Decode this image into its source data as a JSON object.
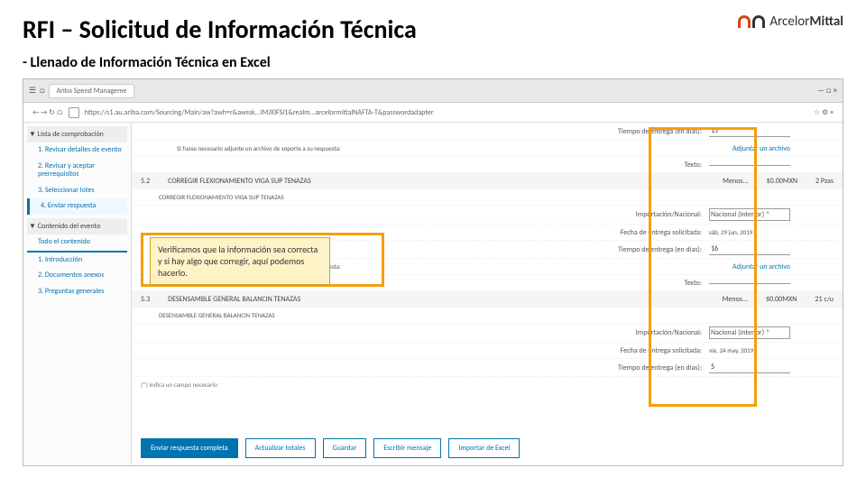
{
  "header": {
    "title": "RFI – Solicitud de Información Técnica",
    "logo_brand1": "Arcelor",
    "logo_brand2": "Mittal"
  },
  "subtitle": "- Llenado de Información Técnica en Excel",
  "browser": {
    "tab": "Ariba Spend Manageme",
    "url": "https://s1.au.ariba.com/Sourcing/Main/aw?awh=r&awssk...IMJI0FSI1&realm...arcelormittalNAFTA-T&passwordadapter"
  },
  "sidebar": {
    "header": "▼ Lista de comprobación",
    "items": [
      "1. Revisar detalles de evento",
      "2. Revisar y aceptar prerrequisitos",
      "3. Seleccionar lotes",
      "4. Enviar respuesta"
    ],
    "section2": "▼ Contenido del evento",
    "items2": [
      "Todo el contenido",
      "1. Introducción",
      "2. Documentos anexos",
      "3. Preguntas generales"
    ]
  },
  "main": {
    "r1_lbl": "Tiempo de entrega (en días):",
    "r1_val": "15",
    "r2_txt": "Si fuese necesario adjunte un archivo de soporte a su respuesta:",
    "r2_lnk": "Adjuntar un archivo",
    "r3_lbl": "Texto:",
    "sec1_num": "5.2",
    "sec1_name": "CORREGIR FLEXIONAMIENTO VIGA SUP TENAZAS",
    "sec1_link": "Menos...",
    "sec1_amt": "$0.00MXN",
    "sec1_qty": "2 Pzas",
    "sec1_sub": "CORREGIR FLEXIONAMIENTO VIGA SUP TENAZAS",
    "r4_lbl": "Importación/Nacional:",
    "r4_val": "Nacional (interior)",
    "r5_lbl": "Fecha de entrega solicitada:",
    "r5_val": "sáb, 29 jun, 2019",
    "r6_lbl": "Tiempo de entrega (en días):",
    "r6_val": "16",
    "r7_txt": "Si fuese necesario adjunte un archivo de soporte a su respuesta:",
    "r7_lnk": "Adjuntar un archivo",
    "r8_lbl": "Texto:",
    "sec2_num": "5.3",
    "sec2_name": "DESENSAMBLE GENERAL BALANCIN TENAZAS",
    "sec2_link": "Menos...",
    "sec2_amt": "$0.00MXN",
    "sec2_qty": "21 c/u",
    "sec2_sub": "DESENSAMBLE GENERAL BALANCIN TENAZAS",
    "r9_lbl": "Importación/Nacional:",
    "r9_val": "Nacional (interior)",
    "r10_lbl": "Fecha de entrega solicitada:",
    "r10_val": "vie, 24 may, 2019",
    "r11_lbl": "Tiempo de entrega (en días):",
    "r11_val": "5",
    "note": "(*) indica un campo necesario"
  },
  "callout": "Verificamos que la información sea correcta y si hay algo que corregir, aquí podemos hacerlo.",
  "buttons": {
    "b1": "Enviar respuesta completa",
    "b2": "Actualizar totales",
    "b3": "Guardar",
    "b4": "Escribir mensaje",
    "b5": "Importar de Excel"
  }
}
